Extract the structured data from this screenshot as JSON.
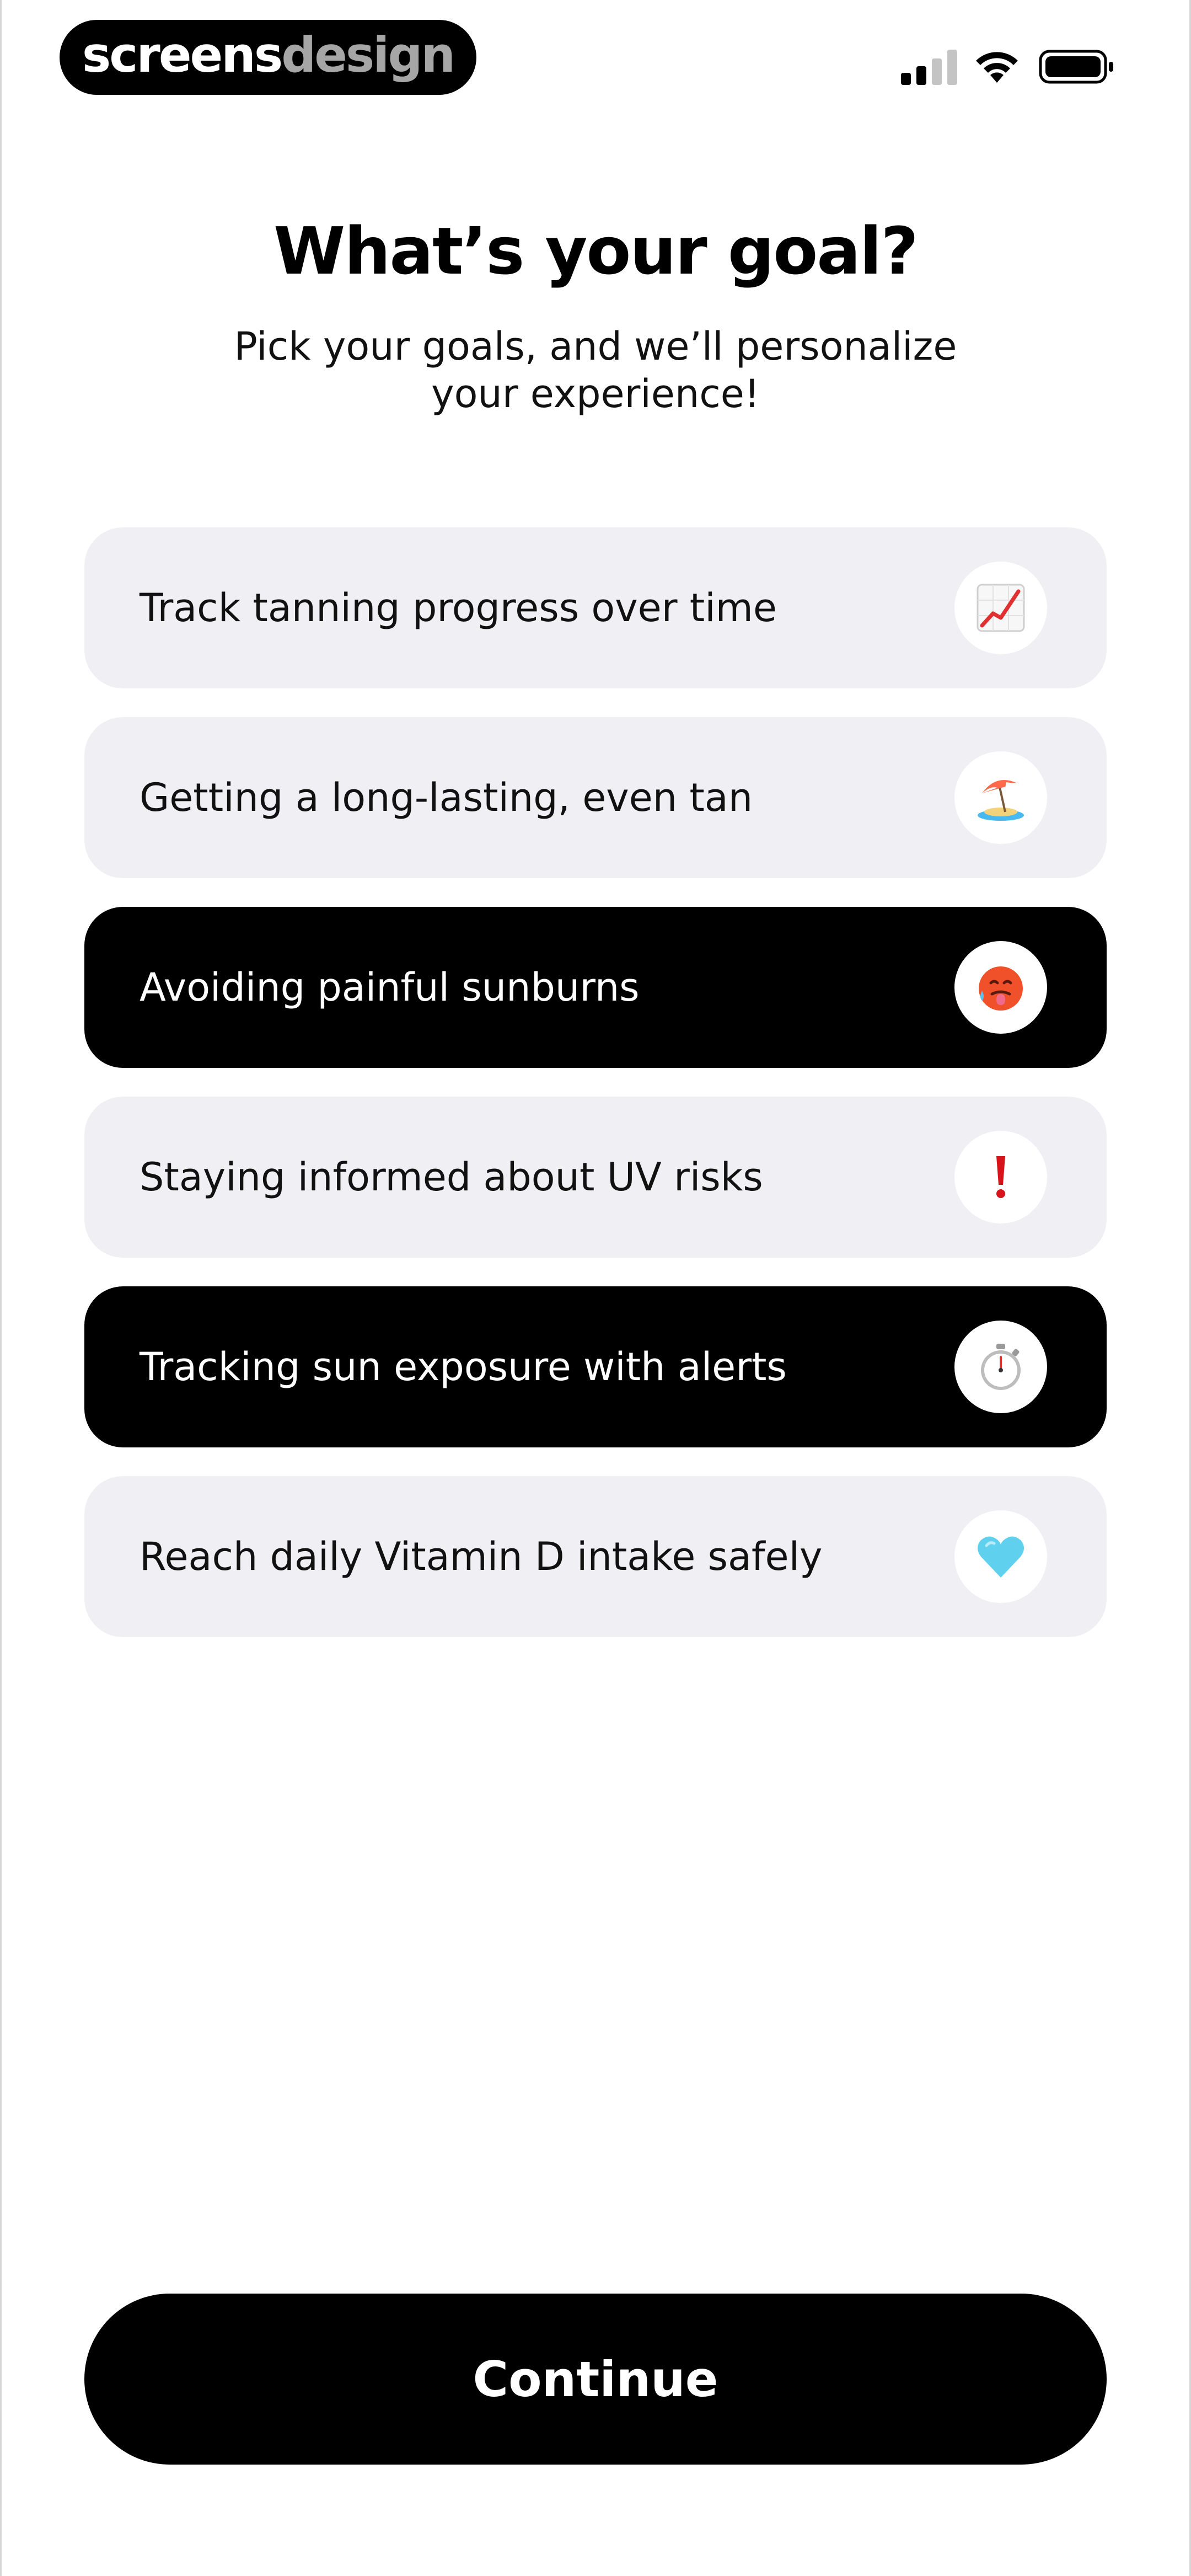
{
  "status_bar": {
    "brand_part1": "screens",
    "brand_part2": "design",
    "signal": "cellular-signal-icon",
    "wifi": "wifi-icon",
    "battery": "battery-icon"
  },
  "header": {
    "title": "What’s your goal?",
    "subtitle": "Pick your goals, and we’ll personalize your experience!"
  },
  "goals": [
    {
      "label": "Track tanning progress over time",
      "icon": "chart-increasing-icon",
      "selected": false
    },
    {
      "label": "Getting a long-lasting, even tan",
      "icon": "beach-umbrella-icon",
      "selected": false
    },
    {
      "label": "Avoiding painful sunburns",
      "icon": "hot-face-icon",
      "selected": true
    },
    {
      "label": "Staying informed about UV risks",
      "icon": "exclamation-mark-icon",
      "selected": false
    },
    {
      "label": "Tracking sun exposure with alerts",
      "icon": "stopwatch-icon",
      "selected": true
    },
    {
      "label": "Reach daily Vitamin D intake safely",
      "icon": "light-blue-heart-icon",
      "selected": false
    }
  ],
  "footer": {
    "continue_label": "Continue"
  },
  "colors": {
    "background": "#ffffff",
    "option_default": "#f0f0f4",
    "option_selected": "#000000",
    "button": "#000000",
    "brand_grey": "#a6a6a6"
  }
}
